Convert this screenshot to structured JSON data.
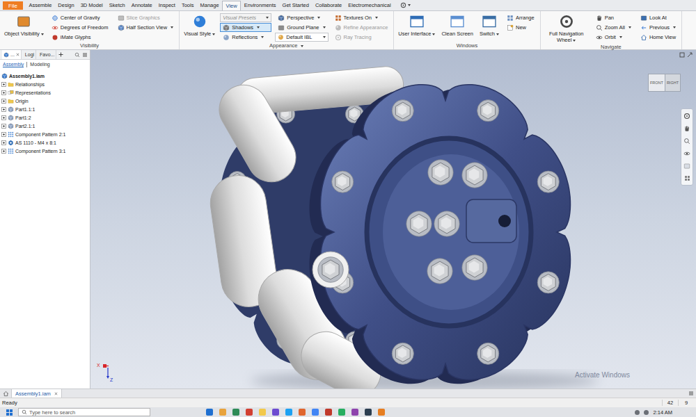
{
  "app": {
    "file_tab": "File"
  },
  "ribbon_tabs": [
    {
      "label": "Assemble",
      "selected": false
    },
    {
      "label": "Design",
      "selected": false
    },
    {
      "label": "3D Model",
      "selected": false
    },
    {
      "label": "Sketch",
      "selected": false
    },
    {
      "label": "Annotate",
      "selected": false
    },
    {
      "label": "Inspect",
      "selected": false
    },
    {
      "label": "Tools",
      "selected": false
    },
    {
      "label": "Manage",
      "selected": false
    },
    {
      "label": "View",
      "selected": true
    },
    {
      "label": "Environments",
      "selected": false
    },
    {
      "label": "Get Started",
      "selected": false
    },
    {
      "label": "Collaborate",
      "selected": false
    },
    {
      "label": "Electromechanical",
      "selected": false
    }
  ],
  "ribbon_panels": [
    {
      "title": "Visibility",
      "dropdown": false,
      "columns": [
        {
          "kind": "large",
          "items": [
            {
              "label": "Object Visibility",
              "kind": "button",
              "dropdown": true,
              "disabled": false,
              "selected": false
            }
          ]
        },
        {
          "kind": "stack",
          "items": [
            {
              "label": "Center of Gravity",
              "kind": "button",
              "dropdown": false,
              "disabled": false,
              "selected": false
            },
            {
              "label": "Degrees of Freedom",
              "kind": "button",
              "dropdown": false,
              "disabled": false,
              "selected": false
            },
            {
              "label": "iMate Glyphs",
              "kind": "button",
              "dropdown": false,
              "disabled": false,
              "selected": false
            }
          ]
        },
        {
          "kind": "stack",
          "items": [
            {
              "label": "Slice Graphics",
              "kind": "button",
              "dropdown": false,
              "disabled": true,
              "selected": false
            },
            {
              "label": "Half Section View",
              "kind": "button",
              "dropdown": true,
              "disabled": false,
              "selected": false
            }
          ]
        }
      ]
    },
    {
      "title": "Appearance",
      "dropdown": true,
      "columns": [
        {
          "kind": "large",
          "items": [
            {
              "label": "Visual Style",
              "kind": "button",
              "dropdown": true,
              "disabled": false,
              "selected": false
            }
          ]
        },
        {
          "kind": "stack",
          "items": [
            {
              "label": "Visual Presets",
              "kind": "select",
              "dropdown": true,
              "disabled": true,
              "selected": false
            },
            {
              "label": "Shadows",
              "kind": "button",
              "dropdown": true,
              "disabled": false,
              "selected": true
            },
            {
              "label": "Reflections",
              "kind": "button",
              "dropdown": true,
              "disabled": false,
              "selected": false
            }
          ]
        },
        {
          "kind": "stack",
          "items": [
            {
              "label": "Perspective",
              "kind": "button",
              "dropdown": true,
              "disabled": false,
              "selected": false
            },
            {
              "label": "Ground Plane",
              "kind": "button",
              "dropdown": true,
              "disabled": false,
              "selected": false
            },
            {
              "label": "Default IBL",
              "kind": "select",
              "dropdown": true,
              "disabled": false,
              "selected": false
            }
          ]
        },
        {
          "kind": "stack",
          "items": [
            {
              "label": "Textures On",
              "kind": "button",
              "dropdown": true,
              "disabled": false,
              "selected": false
            },
            {
              "label": "Refine Appearance",
              "kind": "button",
              "dropdown": false,
              "disabled": true,
              "selected": false
            },
            {
              "label": "Ray Tracing",
              "kind": "button",
              "dropdown": false,
              "disabled": true,
              "selected": false
            }
          ]
        }
      ]
    },
    {
      "title": "Windows",
      "dropdown": false,
      "columns": [
        {
          "kind": "large",
          "items": [
            {
              "label": "User Interface",
              "kind": "button",
              "dropdown": true,
              "disabled": false,
              "selected": false
            }
          ]
        },
        {
          "kind": "large",
          "items": [
            {
              "label": "Clean Screen",
              "kind": "button",
              "dropdown": false,
              "disabled": false,
              "selected": false
            }
          ]
        },
        {
          "kind": "large",
          "items": [
            {
              "label": "Switch",
              "kind": "button",
              "dropdown": true,
              "disabled": false,
              "selected": false
            }
          ]
        },
        {
          "kind": "stack",
          "items": [
            {
              "label": "Arrange",
              "kind": "button",
              "dropdown": false,
              "disabled": false,
              "selected": false
            },
            {
              "label": "New",
              "kind": "button",
              "dropdown": false,
              "disabled": false,
              "selected": false
            }
          ]
        }
      ]
    },
    {
      "title": "Navigate",
      "dropdown": false,
      "columns": [
        {
          "kind": "large",
          "items": [
            {
              "label": "Full Navigation Wheel",
              "kind": "button",
              "dropdown": true,
              "disabled": false,
              "selected": false
            }
          ]
        },
        {
          "kind": "stack",
          "items": [
            {
              "label": "Pan",
              "kind": "button",
              "dropdown": false,
              "disabled": false,
              "selected": false
            },
            {
              "label": "Zoom All",
              "kind": "button",
              "dropdown": true,
              "disabled": false,
              "selected": false
            },
            {
              "label": "Orbit",
              "kind": "button",
              "dropdown": true,
              "disabled": false,
              "selected": false
            }
          ]
        },
        {
          "kind": "stack",
          "items": [
            {
              "label": "Look At",
              "kind": "button",
              "dropdown": false,
              "disabled": false,
              "selected": false
            },
            {
              "label": "Previous",
              "kind": "button",
              "dropdown": true,
              "disabled": false,
              "selected": false
            },
            {
              "label": "Home View",
              "kind": "button",
              "dropdown": false,
              "disabled": false,
              "selected": false
            }
          ]
        }
      ]
    }
  ],
  "browser": {
    "tabs": [
      {
        "label": "...",
        "selected": true,
        "closable": true
      },
      {
        "label": "Logi",
        "selected": false,
        "closable": false
      },
      {
        "label": "Favo...",
        "selected": false,
        "closable": false
      }
    ],
    "modes": [
      {
        "label": "Assembly",
        "selected": true
      },
      {
        "label": "Modeling",
        "selected": false
      }
    ],
    "root": "Assembly1.iam",
    "items": [
      {
        "label": "Relationships",
        "kind": "folder",
        "expanded": false
      },
      {
        "label": "Representations",
        "kind": "representations",
        "expanded": false
      },
      {
        "label": "Origin",
        "kind": "folder",
        "expanded": false
      },
      {
        "label": "Part1.1:1",
        "kind": "part",
        "expanded": false
      },
      {
        "label": "Part1:2",
        "kind": "part",
        "expanded": false
      },
      {
        "label": "Part2.1:1",
        "kind": "part",
        "expanded": false
      },
      {
        "label": "Component Pattern 2:1",
        "kind": "pattern",
        "expanded": false
      },
      {
        "label": "AS 1110 - M4 x 8:1",
        "kind": "fastener",
        "expanded": false
      },
      {
        "label": "Component Pattern 3:1",
        "kind": "pattern",
        "expanded": false
      }
    ]
  },
  "viewport": {
    "view_cube": [
      "FRONT",
      "RIGHT"
    ],
    "axes": [
      {
        "label": "X",
        "color": "#d8252b"
      },
      {
        "label": "Z",
        "color": "#2336c9"
      }
    ],
    "watermark": "Activate Windows"
  },
  "doc_tabs": [
    {
      "label": "Assembly1.iam",
      "selected": true,
      "closable": true
    }
  ],
  "status": {
    "text": "Ready",
    "values": [
      "42",
      "9"
    ]
  },
  "taskbar": {
    "search_placeholder": "Type here to search",
    "time": "2:14 AM"
  }
}
